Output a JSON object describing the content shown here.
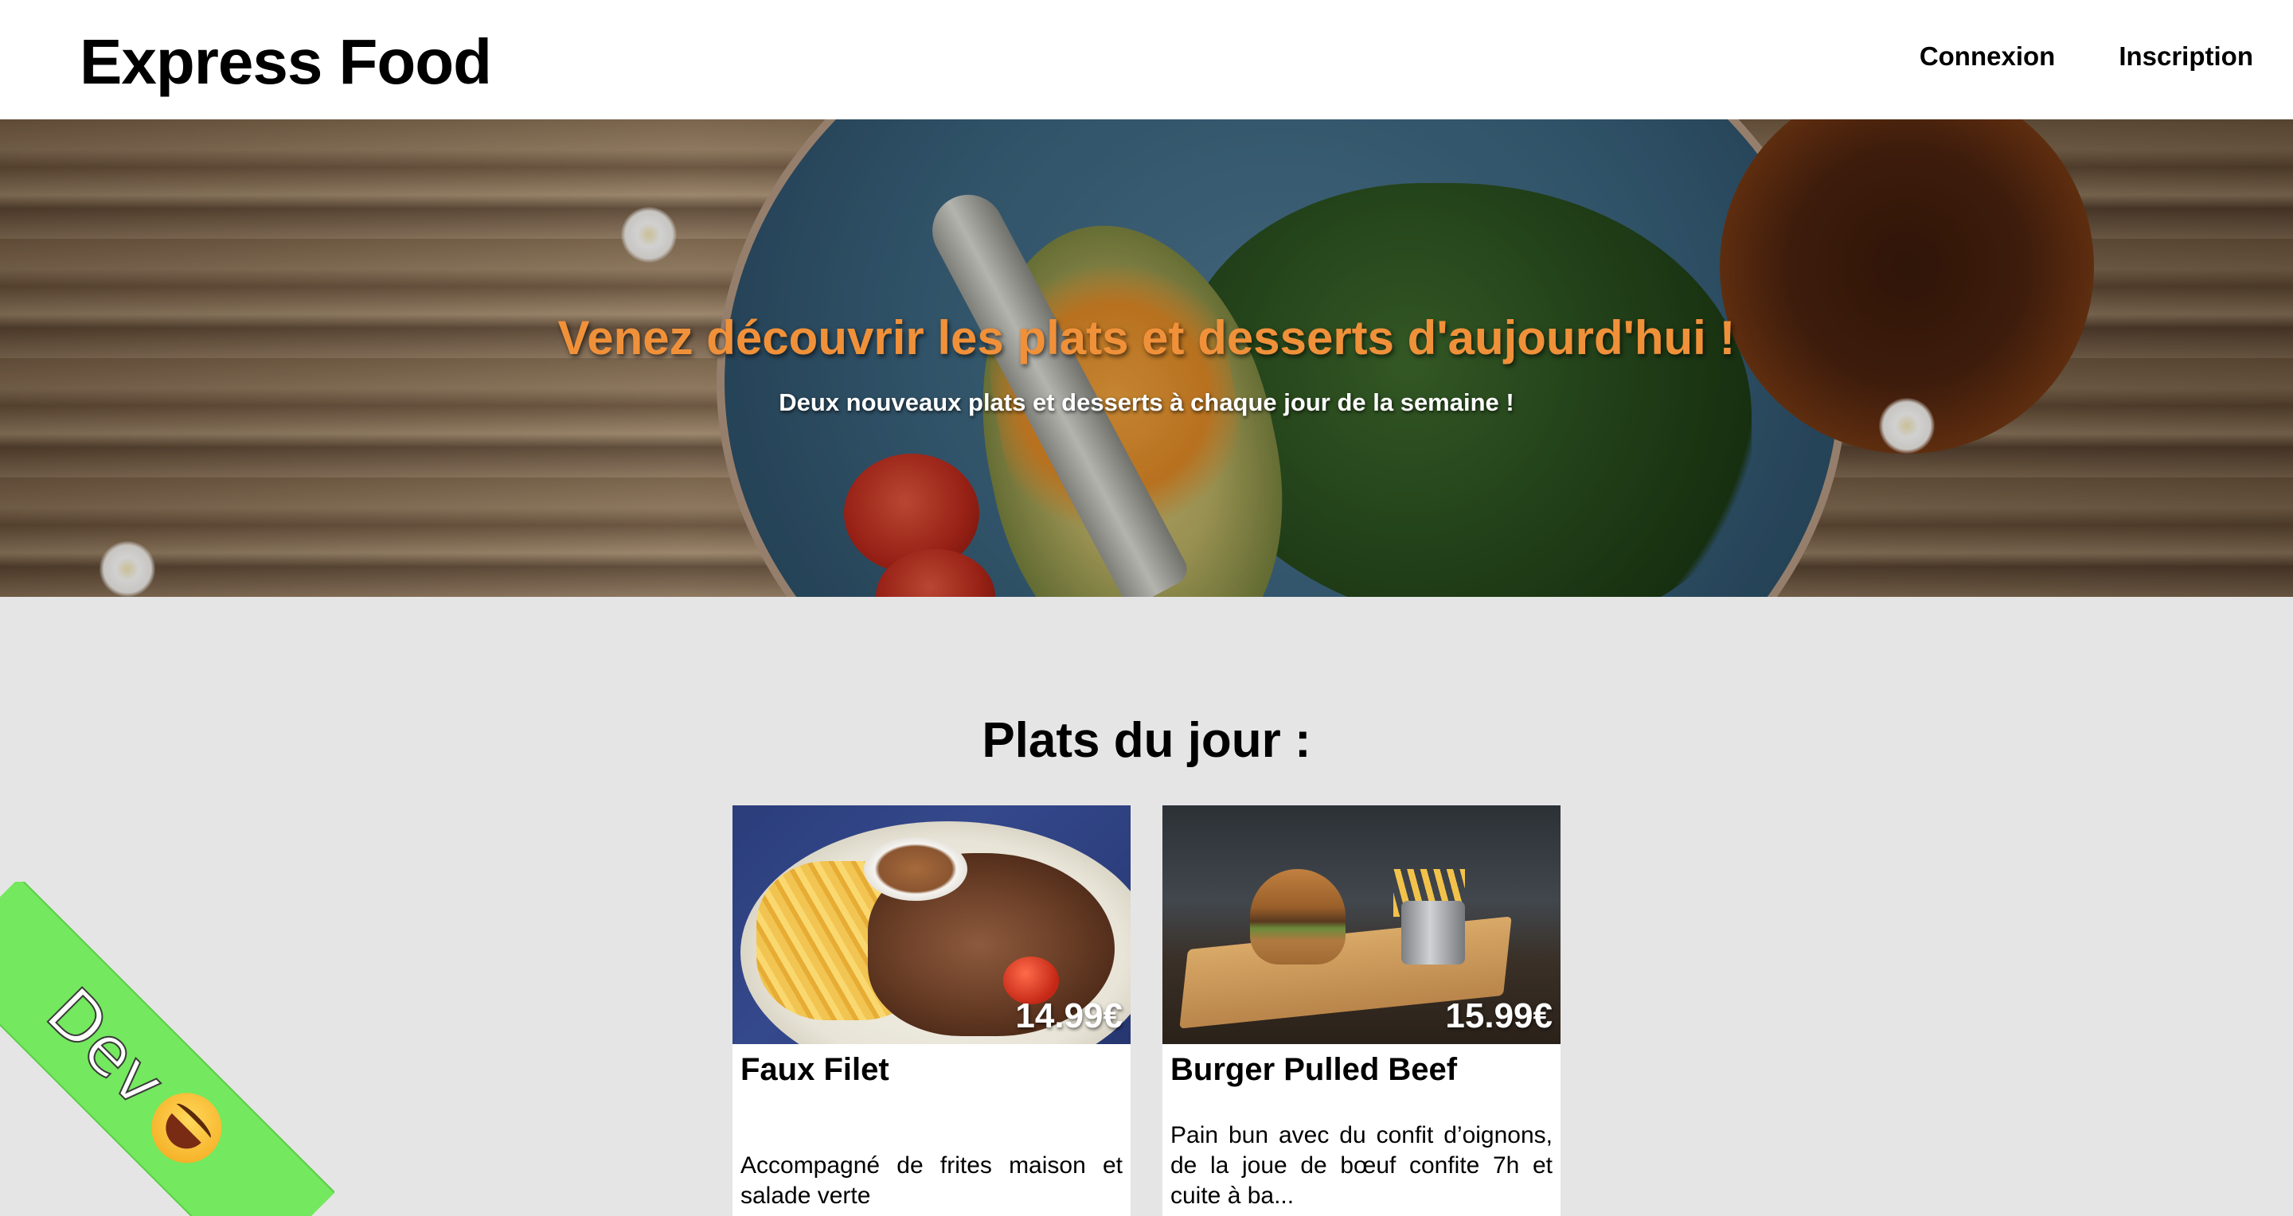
{
  "header": {
    "brand": "Express Food",
    "nav": [
      {
        "label": "Connexion"
      },
      {
        "label": "Inscription"
      }
    ]
  },
  "hero": {
    "title": "Venez découvrir les plats et desserts d'aujourd'hui !",
    "subtitle": "Deux nouveaux plats et desserts à chaque jour de la semaine !"
  },
  "section": {
    "title": "Plats du jour :"
  },
  "dishes": [
    {
      "name": "Faux Filet",
      "price": "14.99€",
      "description": "Accompagné de frites maison et salade verte"
    },
    {
      "name": "Burger Pulled Beef",
      "price": "15.99€",
      "description": "Pain bun avec du confit d’oignons, de la joue de bœuf confite 7h et cuite à ba..."
    }
  ],
  "ribbon": {
    "label": "Dev",
    "emoji": "laughing-tears-emoji"
  },
  "colors": {
    "hero_title": "#f0913a",
    "page_background": "#e5e5e5",
    "ribbon": "#74e85e"
  }
}
